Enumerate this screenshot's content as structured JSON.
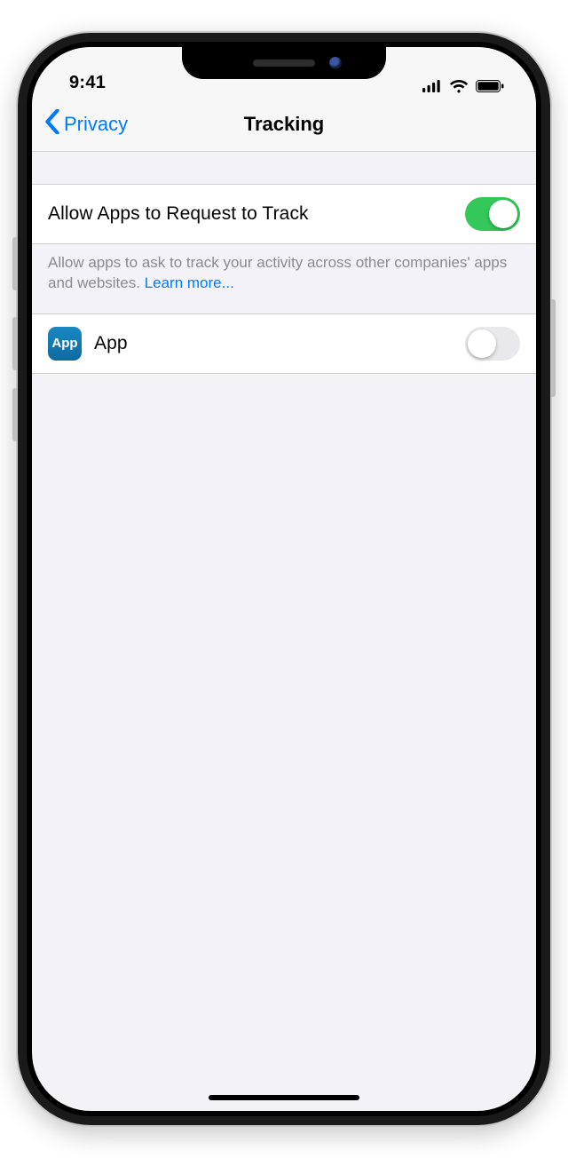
{
  "statusbar": {
    "time": "9:41"
  },
  "nav": {
    "back_label": "Privacy",
    "title": "Tracking"
  },
  "main_toggle": {
    "label": "Allow Apps to Request to Track",
    "enabled": true
  },
  "footer": {
    "text": "Allow apps to ask to track your activity across other companies' apps and websites. ",
    "link": "Learn more..."
  },
  "apps": [
    {
      "icon_text": "App",
      "name": "App",
      "enabled": false
    }
  ],
  "colors": {
    "tint": "#007aff",
    "switch_on": "#34c759",
    "bg": "#f2f2f7"
  }
}
